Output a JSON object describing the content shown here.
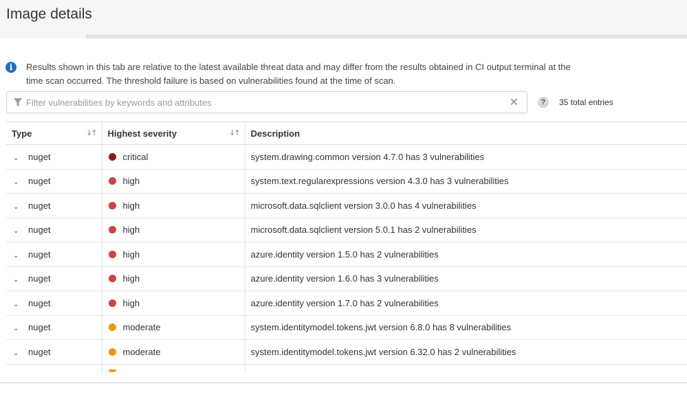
{
  "header": {
    "title": "Image details"
  },
  "info": {
    "text": "Results shown in this tab are relative to the latest available threat data and may differ from the results obtained in CI output terminal at the time scan occurred. The threshold failure is based on vulnerabilities found at the time of scan."
  },
  "filter": {
    "placeholder": "Filter vulnerabilities by keywords and attributes",
    "value": ""
  },
  "entries": {
    "label": "35 total entries"
  },
  "table": {
    "headers": {
      "type": "Type",
      "severity": "Highest severity",
      "description": "Description"
    },
    "rows": [
      {
        "type": "nuget",
        "severity": "critical",
        "description": "system.drawing.common version 4.7.0 has 3 vulnerabilities"
      },
      {
        "type": "nuget",
        "severity": "high",
        "description": "system.text.regularexpressions version 4.3.0 has 3 vulnerabilities"
      },
      {
        "type": "nuget",
        "severity": "high",
        "description": "microsoft.data.sqlclient version 3.0.0 has 4 vulnerabilities"
      },
      {
        "type": "nuget",
        "severity": "high",
        "description": "microsoft.data.sqlclient version 5.0.1 has 2 vulnerabilities"
      },
      {
        "type": "nuget",
        "severity": "high",
        "description": "azure.identity version 1.5.0 has 2 vulnerabilities"
      },
      {
        "type": "nuget",
        "severity": "high",
        "description": "azure.identity version 1.6.0 has 3 vulnerabilities"
      },
      {
        "type": "nuget",
        "severity": "high",
        "description": "azure.identity version 1.7.0 has 2 vulnerabilities"
      },
      {
        "type": "nuget",
        "severity": "moderate",
        "description": "system.identitymodel.tokens.jwt version 6.8.0 has 8 vulnerabilities"
      },
      {
        "type": "nuget",
        "severity": "moderate",
        "description": "system.identitymodel.tokens.jwt version 6.32.0 has 2 vulnerabilities"
      }
    ]
  },
  "colors": {
    "critical": "#8b1a1a",
    "high": "#d64040",
    "moderate": "#f0960e",
    "info_icon": "#1f6fc5"
  },
  "icons": {
    "info": "info-icon",
    "filter": "filter-icon",
    "clear": "close-icon",
    "help": "help-icon",
    "sort": "sort-icon",
    "expand": "chevron-down-icon",
    "severity": "severity-dot-icon"
  }
}
